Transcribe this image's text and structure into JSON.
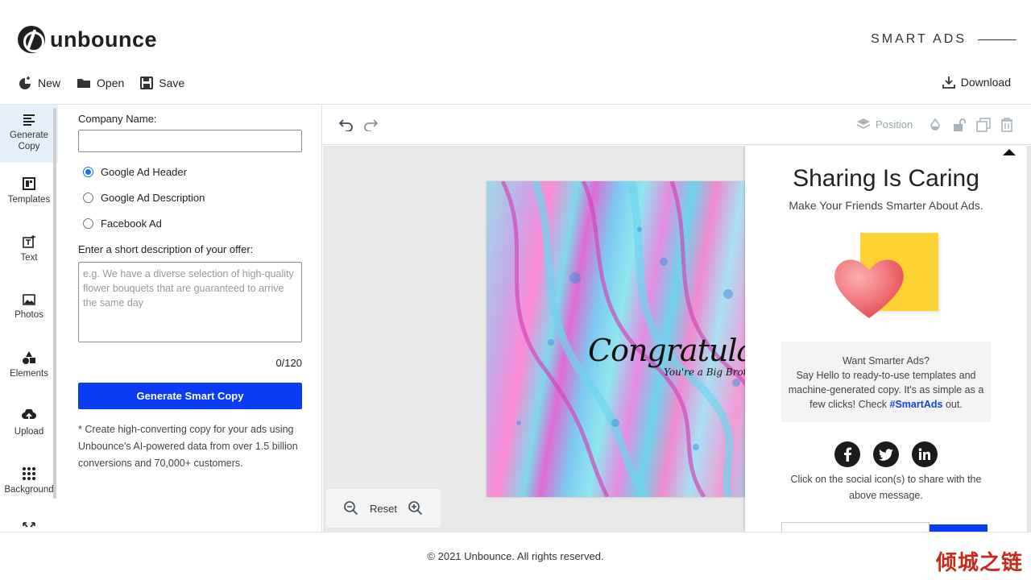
{
  "brand": {
    "name": "unbounce",
    "product": "SMART ADS"
  },
  "toolbar": {
    "new_label": "New",
    "open_label": "Open",
    "save_label": "Save",
    "download_label": "Download"
  },
  "sidebar": {
    "items": [
      {
        "label": "Generate Copy",
        "icon": "align-left-icon",
        "active": true
      },
      {
        "label": "Templates",
        "icon": "templates-icon"
      },
      {
        "label": "Text",
        "icon": "text-icon"
      },
      {
        "label": "Photos",
        "icon": "image-icon"
      },
      {
        "label": "Elements",
        "icon": "shapes-icon"
      },
      {
        "label": "Upload",
        "icon": "upload-icon"
      },
      {
        "label": "Background",
        "icon": "dots-grid-icon"
      }
    ]
  },
  "form": {
    "company_label": "Company Name:",
    "company_value": "",
    "ad_types": [
      {
        "label": "Google Ad Header",
        "checked": true
      },
      {
        "label": "Google Ad Description",
        "checked": false
      },
      {
        "label": "Facebook Ad",
        "checked": false
      }
    ],
    "desc_label": "Enter a short description of your offer:",
    "desc_placeholder": "e.g. We have a diverse selection of high-quality flower bouquets that are guaranteed to arrive the same day",
    "counter": "0/120",
    "generate_label": "Generate Smart Copy",
    "note": "* Create high-converting copy for your ads using Unbounce's AI-powered data from over 1.5 billion conversions and 70,000+ customers."
  },
  "editor": {
    "position_label": "Position",
    "reset_label": "Reset",
    "art_title": "Congratulations",
    "art_subtitle": "You're a Big Brother"
  },
  "share": {
    "title": "Sharing Is Caring",
    "subtitle": "Make Your Friends Smarter About Ads.",
    "promo_line1": "Want Smarter Ads?",
    "promo_line2": "Say Hello to ready-to-use templates and machine-generated copy. It's as simple as a few clicks! Check",
    "promo_tag": "#SmartAds",
    "promo_end": "out.",
    "note": "Click on the social icon(s) to share with the above message.",
    "socials": [
      "facebook-icon",
      "twitter-icon",
      "linkedin-icon"
    ]
  },
  "footer": {
    "copyright": "© 2021 Unbounce. All rights reserved."
  },
  "watermark": "倾城之链",
  "colors": {
    "accent": "#0b3cf5",
    "active_nav": "#e6f0fa",
    "sticky": "#ffd233"
  }
}
